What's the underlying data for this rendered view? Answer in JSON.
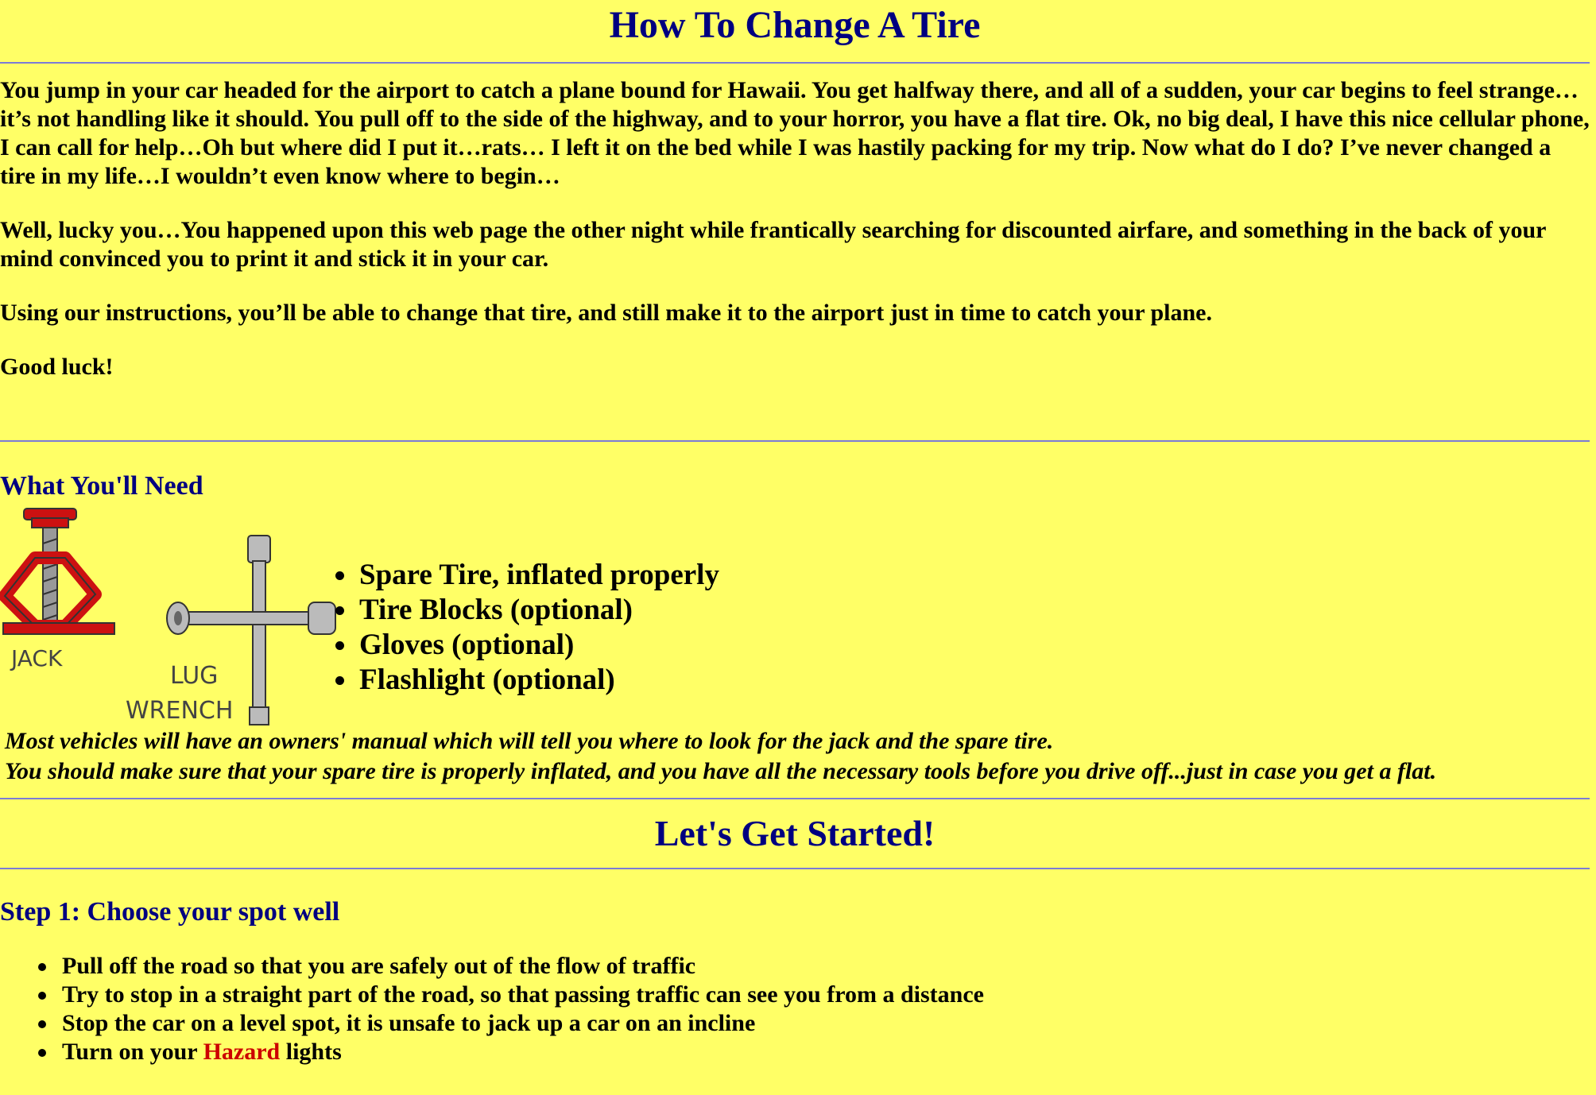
{
  "page": {
    "title": "How To Change A Tire",
    "background_color": "#ffff66",
    "heading_color": "#000080"
  },
  "intro": {
    "paragraphs": [
      "You jump in your car headed for the airport to catch a plane bound for Hawaii.  You get halfway there, and all of a sudden, your car begins to feel strange…it’s not handling like it should.  You pull off to the side of the highway, and to your horror, you have a flat tire.  Ok, no big deal, I have this nice cellular phone, I can call for help…Oh but where did I put it…rats… I left it on the bed while I was hastily packing for my trip.  Now what do I do? I’ve never changed a tire in my life…I wouldn’t even know where to begin…",
      "Well, lucky you…You happened upon this web page the other night while frantically searching for discounted airfare, and something in the back of your mind convinced you to print it and stick it in your car.",
      "Using our instructions, you’ll be able to change that tire, and still make it to the airport just in time to catch your plane.",
      "Good luck!"
    ]
  },
  "need": {
    "heading": "What You'll Need",
    "jack_label": "JACK",
    "wrench_label_1": "LUG",
    "wrench_label_2": "WRENCH",
    "items": [
      "Spare Tire, inflated properly",
      "Tire Blocks (optional)",
      "Gloves (optional)",
      "Flashlight (optional)"
    ],
    "note_1": "Most vehicles will have an owners' manual which will tell you where to look for the jack and the spare tire.",
    "note_2": "You should make sure that your spare tire is properly inflated, and you have all the necessary tools before you drive off...just in case you get a flat."
  },
  "started": {
    "heading": "Let's Get Started!"
  },
  "step1": {
    "heading": "Step 1: Choose your spot well",
    "items": [
      "Pull off the road so that you are safely out of the flow of traffic",
      "Try to stop in a straight part of the road, so that passing traffic can see you from a distance",
      "Stop the car on a level spot, it is unsafe to jack up a car on an incline"
    ],
    "last_item_prefix": "Turn on your ",
    "last_item_highlight": "Hazard",
    "last_item_suffix": " lights",
    "highlight_color": "#cc0000"
  }
}
